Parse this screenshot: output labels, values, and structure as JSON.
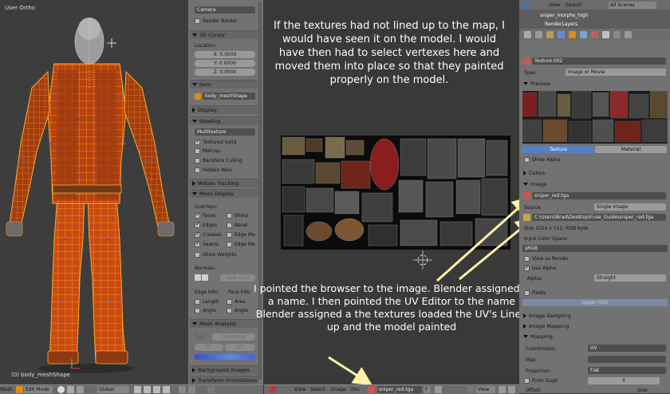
{
  "viewport": {
    "title": "User Ortho",
    "object_label": "(0) body_meshShape"
  },
  "bottom_bar": {
    "left_label": "Mesh",
    "mode": "Edit Mode",
    "orientation": "Global",
    "uv_menu": [
      "View",
      "Select",
      "Image",
      "UVs"
    ],
    "image_name": "sniper_red.tga",
    "view_label": "View",
    "f_label": "F"
  },
  "tool_panel": {
    "camera_field": "Camera",
    "render_border": "Render Border",
    "cursor_section": "3D Cursor",
    "location_label": "Location:",
    "x": "X: 0.0000",
    "y": "Y: 0.0000",
    "z": "Z: 0.0000",
    "item_section": "Item",
    "item_name": "body_meshShape",
    "display_section": "Display",
    "shading_section": "Shading",
    "shading_mode": "Multitexture",
    "textured_solid": "Textured Solid",
    "matcap": "Matcap",
    "backface": "Backface Culling",
    "hidden_wire": "Hidden Wire",
    "motion_section": "Motion Tracking",
    "mesh_display_section": "Mesh Display",
    "overlays_label": "Overlays:",
    "faces": "Faces",
    "sharp": "Sharp",
    "edges": "Edges",
    "bevel": "Bevel",
    "creases": "Creases",
    "edge_ma": "Edge Ma",
    "seams": "Seams",
    "edge_ma2": "Edge Ma",
    "show_weights": "Show Weights",
    "normals_label": "Normals:",
    "normal_size": "Size: 0.10",
    "edge_info": "Edge Info:",
    "face_info": "Face Info:",
    "length": "Length",
    "area": "Area",
    "angle": "Angle",
    "angle2": "Angle",
    "mesh_analysis": "Mesh Analysis",
    "type_label": "Type:",
    "type_value": "Overhang",
    "range_lo": "0°",
    "range_hi": "45°",
    "bg_images": "Background Images",
    "transform_orient": "Transform Orientations"
  },
  "annotations": {
    "top": "If the textures had not lined up to the map, I would have seen it on the model. I would have then had to select vertexes here and moved them into place so that they painted properly on the model.",
    "bottom": "I pointed the browser to the image. Blender assigned it a name. I then pointed the UV Editor to the name Blender assigned a the textures loaded the UV's Lined up and the model painted"
  },
  "properties": {
    "header_menu": [
      "View",
      "Search"
    ],
    "scenes": "All Scenes",
    "tree_object": "sniper_morphs_high",
    "tree_layers": "RenderLayers",
    "texture_name": "Texture.002",
    "type_label": "Type:",
    "type_value": "Image or Movie",
    "preview_section": "Preview",
    "tab_texture": "Texture",
    "tab_material": "Material",
    "show_alpha": "Show Alpha",
    "colors_section": "Colors",
    "image_section": "Image",
    "image_name": "sniper_red.tga",
    "source_label": "Source:",
    "source_value": "Single Image",
    "filepath": "C:\\Users\\Brad\\Desktop\\Fuse_Guide\\sniper_red.tga",
    "size_info": "Size 1024 x 512, RGB byte",
    "input_color_label": "Input Color Space:",
    "color_space": "sRGB",
    "view_as_render": "View as Render",
    "use_alpha": "Use Alpha",
    "alpha_label": "Alpha:",
    "alpha_value": "Straight",
    "fields": "Fields",
    "upper_first": "Upper First",
    "img_sampling": "Image Sampling",
    "img_mapping": "Image Mapping",
    "mapping_section": "Mapping",
    "coordinates_label": "Coordinates:",
    "coordinates_value": "UV",
    "map_label": "Map:",
    "projection_label": "Projection:",
    "projection_value": "Flat",
    "from_dupli": "From Dupli",
    "x_axis": "X",
    "offset_label": "Offset:",
    "size_label": "Size:"
  },
  "colors": {
    "wire_orange": "#f5a623",
    "selected_blue": "#5680c2",
    "arrow_yellow": "#fff3a8"
  }
}
